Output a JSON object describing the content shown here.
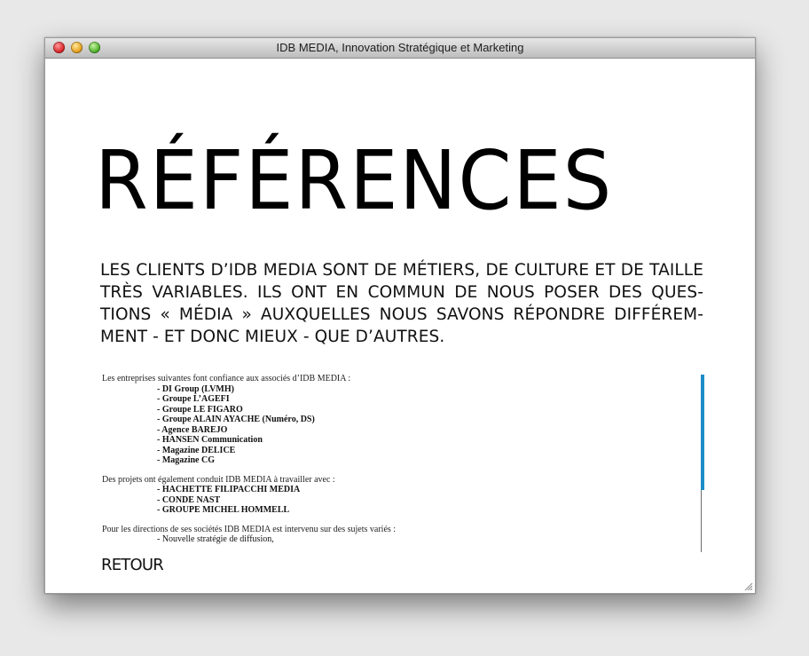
{
  "window": {
    "title": "IDB MEDIA, Innovation Stratégique et Marketing"
  },
  "page": {
    "heading": "RÉFÉRENCES",
    "intro": "LES CLIENTS D’IDB MEDIA SONT DE MÉTIERS, DE CULTURE ET DE TAILLE TRÈS VARIABLES. ILS ONT EN COMMUN  DE NOUS POSER DES QUES-TIONS « MÉDIA » AUXQUELLES NOUS SAVONS RÉPONDRE DIFFÉREM-MENT - ET DONC MIEUX - QUE D’AUTRES.",
    "back_label": "RETOUR"
  },
  "sections": {
    "clients": {
      "intro": "Les entreprises suivantes font confiance aux associés d’IDB MEDIA :",
      "items": [
        "- DI Group (LVMH)",
        "- Groupe L’AGEFI",
        "- Groupe LE FIGARO",
        "- Groupe ALAIN AYACHE (Numéro, DS)",
        "- Agence BAREJO",
        "- HANSEN Communication",
        "- Magazine DELICE",
        "- Magazine CG"
      ]
    },
    "projects": {
      "intro": "Des projets ont également conduit IDB MEDIA à travailler avec :",
      "items": [
        "- HACHETTE FILIPACCHI MEDIA",
        "- CONDE NAST",
        "- GROUPE MICHEL HOMMELL"
      ]
    },
    "directions": {
      "intro": "Pour les directions de ses sociétés IDB MEDIA est intervenu sur des sujets variés :",
      "items": [
        "- Nouvelle stratégie de diffusion,"
      ]
    }
  },
  "colors": {
    "scroll_thumb": "#1c8cc8",
    "text": "#111111"
  },
  "icons": {
    "close": "close-button-icon",
    "minimize": "minimize-button-icon",
    "zoom": "zoom-button-icon",
    "resize": "resize-grip-icon"
  }
}
